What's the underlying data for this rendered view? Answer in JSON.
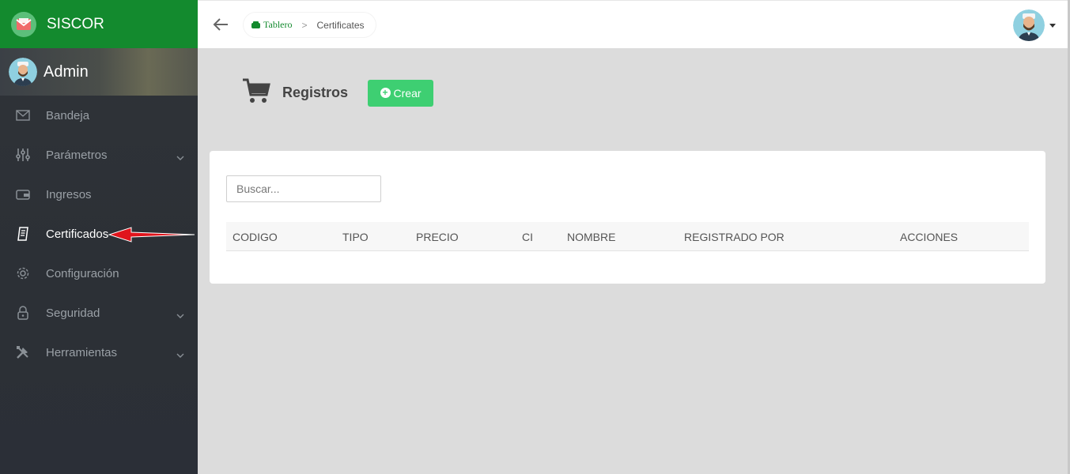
{
  "brand": {
    "name": "SISCOR"
  },
  "user": {
    "name": "Admin"
  },
  "menu": [
    {
      "label": "Bandeja",
      "icon": "envelope-icon",
      "expandable": false
    },
    {
      "label": "Parámetros",
      "icon": "sliders-icon",
      "expandable": true
    },
    {
      "label": "Ingresos",
      "icon": "wallet-icon",
      "expandable": false
    },
    {
      "label": "Certificados",
      "icon": "certificate-icon",
      "expandable": false,
      "active": true
    },
    {
      "label": "Configuración",
      "icon": "gear-icon",
      "expandable": false
    },
    {
      "label": "Seguridad",
      "icon": "lock-icon",
      "expandable": true
    },
    {
      "label": "Herramientas",
      "icon": "tools-icon",
      "expandable": true
    }
  ],
  "breadcrumb": {
    "home": "Tablero",
    "current": "Certificates"
  },
  "page": {
    "title": "Registros",
    "create_label": "Crear"
  },
  "search": {
    "placeholder": "Buscar..."
  },
  "table": {
    "columns": [
      "CODIGO",
      "TIPO",
      "PRECIO",
      "CI",
      "NOMBRE",
      "REGISTRADO POR",
      "ACCIONES"
    ]
  },
  "colors": {
    "brand": "#138a2e",
    "create_button": "#3ecf72",
    "sidebar": "#2f3338",
    "annotation_arrow": "#e0141c"
  }
}
